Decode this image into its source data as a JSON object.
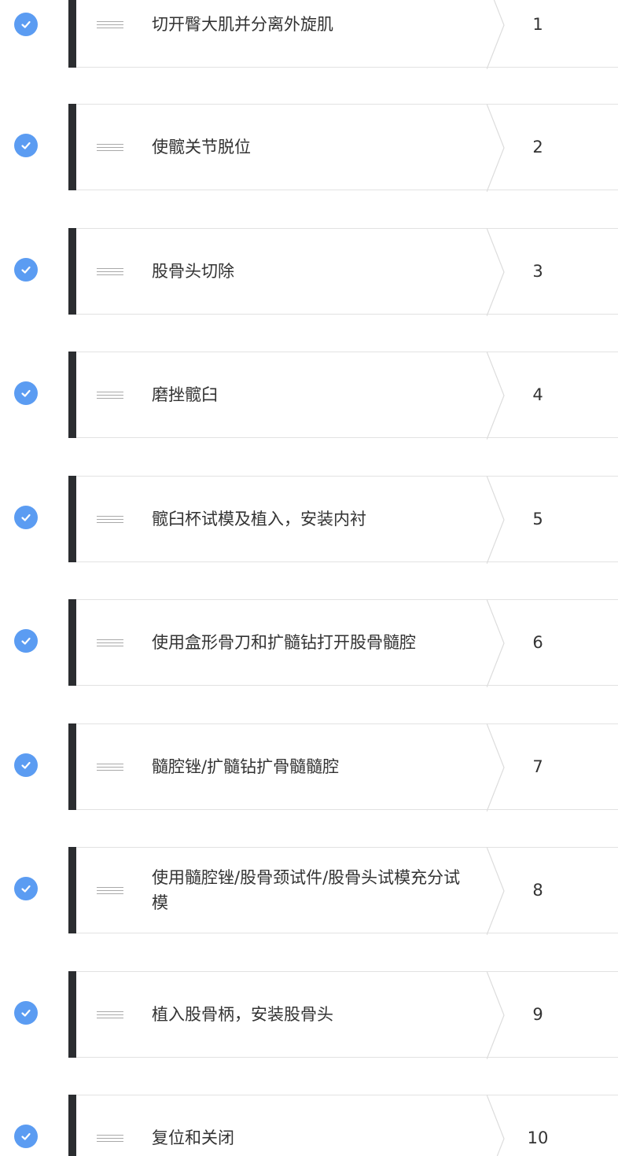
{
  "steps": [
    {
      "label": "切开臀大肌并分离外旋肌",
      "number": "1",
      "done": true
    },
    {
      "label": "使髋关节脱位",
      "number": "2",
      "done": true
    },
    {
      "label": "股骨头切除",
      "number": "3",
      "done": true
    },
    {
      "label": "磨挫髋臼",
      "number": "4",
      "done": true
    },
    {
      "label": "髋臼杯试模及植入，安装内衬",
      "number": "5",
      "done": true
    },
    {
      "label": "使用盒形骨刀和扩髓钻打开股骨髓腔",
      "number": "6",
      "done": true
    },
    {
      "label": "髓腔锉/扩髓钻扩骨髓髓腔",
      "number": "7",
      "done": true
    },
    {
      "label": "使用髓腔锉/股骨颈试件/股骨头试模充分试模",
      "number": "8",
      "done": true
    },
    {
      "label": "植入股骨柄，安装股骨头",
      "number": "9",
      "done": true
    },
    {
      "label": "复位和关闭",
      "number": "10",
      "done": true
    }
  ],
  "icons": {
    "check": "check-circle-icon",
    "drag": "drag-handle-icon",
    "chevron": "chevron-right-icon"
  },
  "colors": {
    "check_bg": "#5b9cf2",
    "accent_bar": "#2b2d30",
    "text": "#333333",
    "border": "#e2e2e2"
  }
}
